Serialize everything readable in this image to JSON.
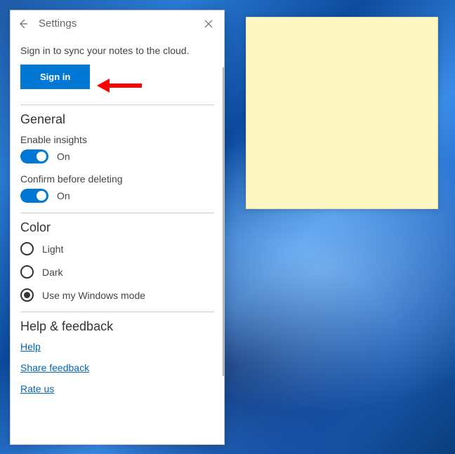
{
  "window": {
    "title": "Settings"
  },
  "sync": {
    "prompt": "Sign in to sync your notes to the cloud.",
    "signin_label": "Sign in"
  },
  "sections": {
    "general": {
      "title": "General",
      "insights": {
        "label": "Enable insights",
        "state": "On"
      },
      "confirm_delete": {
        "label": "Confirm before deleting",
        "state": "On"
      }
    },
    "color": {
      "title": "Color",
      "options": {
        "light": "Light",
        "dark": "Dark",
        "windows": "Use my Windows mode"
      },
      "selected": "windows"
    },
    "help": {
      "title": "Help & feedback",
      "links": {
        "help": "Help",
        "feedback": "Share feedback",
        "rate": "Rate us"
      }
    }
  },
  "colors": {
    "accent": "#0078d4",
    "link": "#0067b8",
    "note": "#fdf7c3",
    "arrow": "#ff0000"
  }
}
